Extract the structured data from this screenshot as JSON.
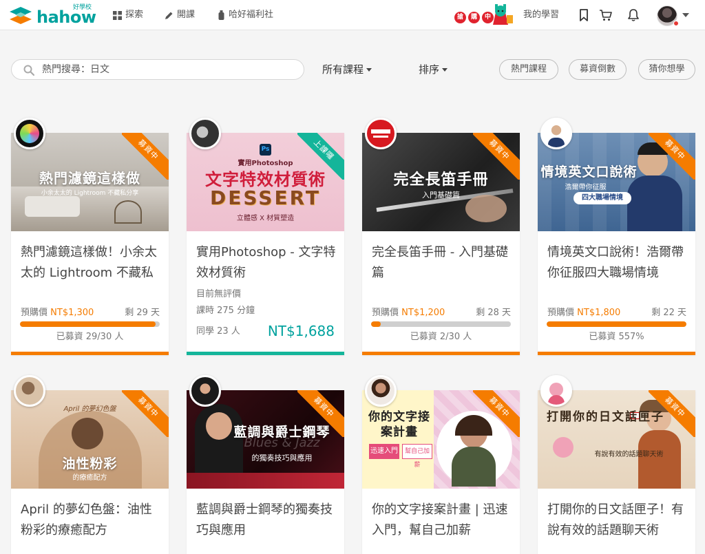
{
  "colors": {
    "brand": "#00a29e",
    "accent_orange": "#f57c00",
    "teal_ribbon": "#14b59a",
    "promo_red": "#e0232e"
  },
  "navbar": {
    "logo_text": "hahow",
    "logo_small": "好學校",
    "explore_label": "探索",
    "teach_label": "開課",
    "perks_label": "哈好福利社",
    "promo_chars": [
      "搶",
      "購",
      "中"
    ],
    "my_learning_label": "我的學習",
    "icons": [
      "bookmark-icon",
      "cart-icon",
      "bell-icon"
    ]
  },
  "search": {
    "placeholder": "熱門搜尋：日文"
  },
  "filters": {
    "all_courses_label": "所有課程",
    "sort_label": "排序",
    "chips": [
      "熱門課程",
      "募資倒數",
      "猜你想學"
    ]
  },
  "cards": [
    {
      "thumb_text": "熱門濾鏡這樣做",
      "thumb_sub": "小余太太的 Lightroom 不藏私分享",
      "ribbon": "募資中",
      "title": "熱門濾鏡這樣做！小余太太的 Lightroom 不藏私分享",
      "presale_label": "預購價",
      "price": "NT$1,300",
      "days_left": "剩 29 天",
      "progress": 0.97,
      "raised_text": "已募資 29/30 人"
    },
    {
      "thumb_text": "文字特效材質術",
      "thumb_top": "實用Photoshop",
      "thumb_word": "DESSERT",
      "thumb_sub": "立體感 X 材質塑造",
      "ribbon": "上課囉",
      "title": "實用Photoshop - 文字特效材質術",
      "rating_text": "目前無評價",
      "duration_text": "課時 275 分鐘",
      "students_text": "同學 23 人",
      "price": "NT$1,688"
    },
    {
      "thumb_text": "完全長笛手冊",
      "thumb_sub": "入門基礎篇",
      "ribbon": "募資中",
      "title": "完全長笛手冊 - 入門基礎篇",
      "presale_label": "預購價",
      "price": "NT$1,200",
      "days_left": "剩 28 天",
      "progress": 0.067,
      "raised_text": "已募資 2/30 人"
    },
    {
      "thumb_text": "情境英文口說術",
      "thumb_sub": "浩爾帶你征服",
      "thumb_badge": "四大職場情境",
      "ribbon": "募資中",
      "title": "情境英文口說術！浩爾帶你征服四大職場情境",
      "presale_label": "預購價",
      "price": "NT$1,800",
      "days_left": "剩 22 天",
      "progress": 1.0,
      "raised_text": "已募資 557%"
    },
    {
      "thumb_text": "油性粉彩",
      "thumb_top": "April 的夢幻色盤",
      "thumb_sub": "的療癒配方",
      "ribbon": "募資中",
      "title": "April 的夢幻色盤：油性粉彩的療癒配方"
    },
    {
      "thumb_text": "藍調與爵士鋼琴",
      "thumb_word": "Blues & Jazz",
      "thumb_sub": "的獨奏技巧與應用",
      "ribbon": "募資中",
      "title": "藍調與爵士鋼琴的獨奏技巧與應用"
    },
    {
      "thumb_text": "你的文字接案計畫",
      "thumb_sub": "迅速入門",
      "thumb_badge": "幫自己加薪",
      "ribbon": "募資中",
      "title": "你的文字接案計畫 | 迅速入門，幫自己加薪"
    },
    {
      "thumb_text": "打開你的日文話匣子",
      "thumb_sub": "有說有效的話題聊天術",
      "ribbon": "募資中",
      "title": "打開你的日文話匣子！有說有效的話題聊天術"
    }
  ]
}
